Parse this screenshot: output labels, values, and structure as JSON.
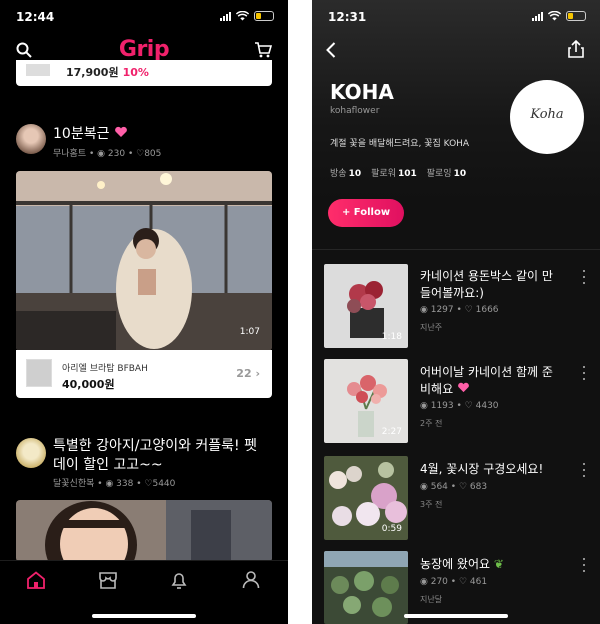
{
  "left": {
    "status": {
      "time": "12:44"
    },
    "logo": "Grip",
    "top_card": {
      "price": "17,900원",
      "discount": "10%"
    },
    "post1": {
      "title": "10분복근",
      "channel": "무나홈트",
      "views": "230",
      "likes": "805",
      "duration": "1:07",
      "product": {
        "name": "아리엘 브라탑 BFBAH",
        "price": "40,000원",
        "count": "22"
      }
    },
    "post2": {
      "title_line1": "특별한 강아지/고양이와 커플룩! 펫",
      "title_line2": "데이 할인 고고~~",
      "channel": "달꽃신한복",
      "views": "338",
      "likes": "5440"
    },
    "nav": [
      {
        "icon": "home-icon",
        "active": true
      },
      {
        "icon": "store-icon",
        "active": false
      },
      {
        "icon": "bell-icon",
        "active": false
      },
      {
        "icon": "profile-icon",
        "active": false
      }
    ],
    "accent": "#f0216b"
  },
  "right": {
    "status": {
      "time": "12:31"
    },
    "profile": {
      "name": "KOHA",
      "handle": "kohaflower",
      "bio": "계절 꽃을 배달해드려요, 꽃집 KOHA",
      "logo_text": "Koha",
      "stats": [
        {
          "label": "방송",
          "value": "10"
        },
        {
          "label": "팔로워",
          "value": "101"
        },
        {
          "label": "팔로잉",
          "value": "10"
        }
      ],
      "follow_label": "+ Follow"
    },
    "videos": [
      {
        "title_line1": "카네이션 용돈박스 같이 만",
        "title_line2": "들어볼까요:)",
        "views": "1297",
        "likes": "1666",
        "date": "지난주",
        "duration": "1:18"
      },
      {
        "title_line1": "어버이날 카네이션 함께 준",
        "title_line2": "비해요",
        "views": "1193",
        "likes": "4430",
        "date": "2주 전",
        "duration": "2:27"
      },
      {
        "title_line1": "4월, 꽃시장 구경오세요!",
        "title_line2": "",
        "views": "564",
        "likes": "683",
        "date": "3주 전",
        "duration": "0:59"
      },
      {
        "title_line1": "농장에 왔어요",
        "title_line2": "",
        "views": "270",
        "likes": "461",
        "date": "지난달",
        "duration": ""
      }
    ]
  }
}
